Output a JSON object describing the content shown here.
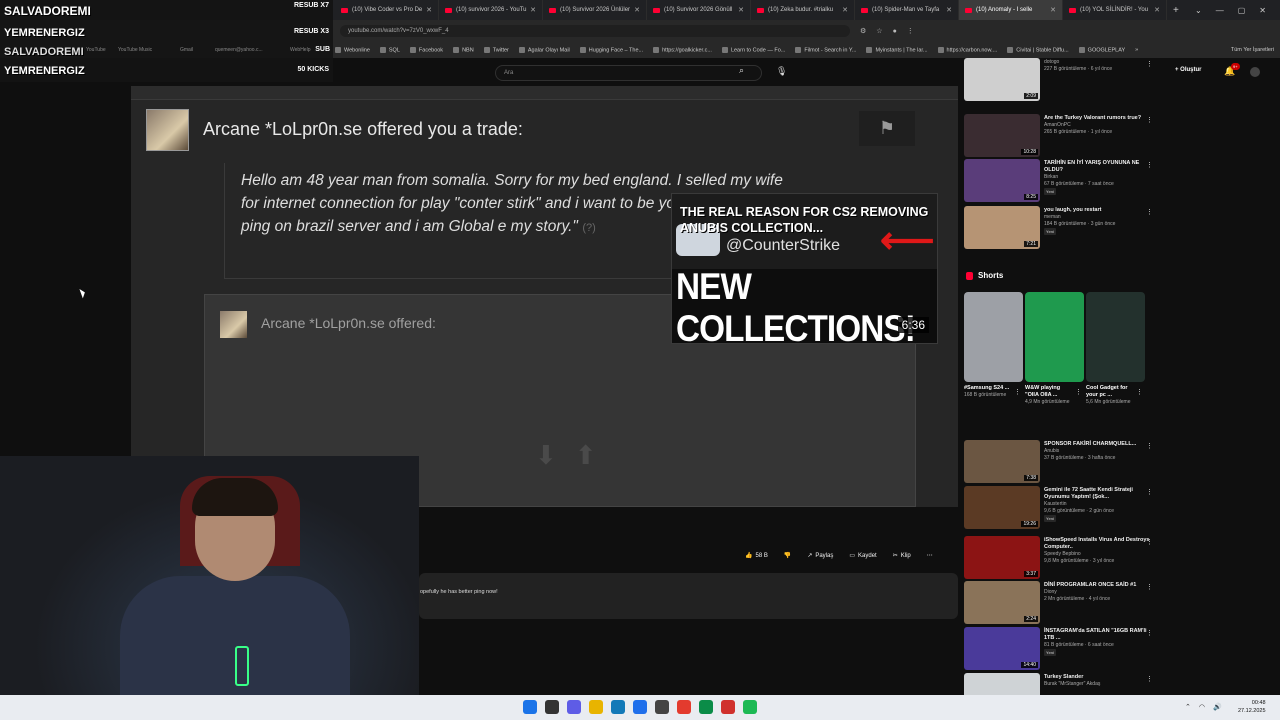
{
  "browser": {
    "tabs": [
      {
        "label": "(10) Vibe Coder vs Pro De",
        "active": false
      },
      {
        "label": "(10) survivor 2026 - YouTu",
        "active": false
      },
      {
        "label": "(10) Survivor 2026 Ünlüler",
        "active": false
      },
      {
        "label": "(10) Survivor 2026 Gönüll",
        "active": false
      },
      {
        "label": "(10) Zeka budur. #trialku",
        "active": false
      },
      {
        "label": "(10) Spider-Man ve Tayfa",
        "active": false
      },
      {
        "label": "(10) Anomaly - I selle",
        "active": true
      },
      {
        "label": "(10) YOL SİLİNDİR! - You",
        "active": false
      }
    ],
    "new_tab": "+",
    "url": "youtube.com/watch?v=7zV0_wxwF_4",
    "bookmarks": [
      "Webonline",
      "SQL",
      "Facebook",
      "NBN",
      "Twitter",
      "Agalar Olayı Mail",
      "Hugging Face – The...",
      "https://goalkicker.c...",
      "Learn to Code — Fo...",
      "Filmot - Search in Y...",
      "Myinstants | The lar...",
      "https://carbon.now....",
      "Civitai | Stable Diffu...",
      "GOOGLEPLAY"
    ],
    "bookmarks_overflow": "»",
    "all_bookmarks": "Tüm Yer İşaretleri"
  },
  "overlay": {
    "lines": [
      "SALVADOREMI",
      "YEMRENERGIZ",
      "SALVADOREMI",
      "YEMRENERGIZ"
    ],
    "tags": [
      "RESUB X7",
      "RESUB X3",
      "SUB",
      "50 KICKS"
    ],
    "faint": [
      "YouTube",
      "YouTube Music",
      "Gmail",
      "quemeen@yahoo.c...",
      "WebHelp"
    ]
  },
  "yt_header": {
    "search_placeholder": "Ara",
    "create_label": "Oluştur",
    "notif_count": "9+"
  },
  "video": {
    "trade_title": "Arcane *LoLpr0n.se offered you a trade:",
    "message": "Hello am 48 year man from somalia. Sorry for my bed england. I selled my wife for internet connection for play \"conter stirk\" and i want to be you I play with 400 ping on brazil server and i am Global e my story.\"",
    "message_q": "(?)",
    "offered_label": "Arcane *LoLpr0n.se offered:"
  },
  "preview": {
    "headline": "THE REAL REASON FOR CS2 REMOVING ANUBIS COLLECTION...",
    "handle": "@CounterStrike",
    "big_text": "NEW COLLECTIONS!",
    "duration": "6:36"
  },
  "actions": {
    "likes": "58 B",
    "share": "Paylaş",
    "save": "Kaydet",
    "clip": "Klip",
    "more": "⋯"
  },
  "comment_text": "opefully he has better ping now!",
  "sidebar": {
    "videos_top": [
      {
        "title": "",
        "channel": "dotogo",
        "meta": "227 B görüntüleme · 6 yıl önce",
        "duration": "2:09",
        "color": "#cfcfcf",
        "new": ""
      },
      {
        "title": "Are the Turkey Valorant rumors true?",
        "channel": "AmanOnPC",
        "meta": "265 B görüntüleme · 1 yıl önce",
        "duration": "10:28",
        "color": "#3a2c31",
        "new": ""
      },
      {
        "title": "TARİHİN EN İYİ YARIŞ OYUNUNA NE OLDU?",
        "channel": "Birkan",
        "meta": "67 B görüntüleme · 7 saat önce",
        "duration": "8:25",
        "color": "#5a3d7a",
        "new": "Yeni"
      },
      {
        "title": "you laugh, you restart",
        "channel": "meman",
        "meta": "184 B görüntüleme · 3 gün önce",
        "duration": "7:21",
        "color": "#b69474",
        "new": "Yeni"
      }
    ],
    "shorts_label": "Shorts",
    "shorts": [
      {
        "title": "#Samsung S24 ...",
        "meta": "168 B görüntüleme",
        "color": "#9da0a6"
      },
      {
        "title": "W&W playing \"OIIA OIIA ...",
        "meta": "4,9 Mn görüntüleme",
        "color": "#1f9a4e"
      },
      {
        "title": "Cool Gadget for your pc ...",
        "meta": "5,6 Mn görüntüleme",
        "color": "#23312d"
      }
    ],
    "videos_bottom": [
      {
        "title": "SPONSOR FAKİRİ CHARMQUELL...",
        "channel": "Anubis",
        "meta": "37 B görüntüleme · 3 hafta önce",
        "duration": "7:38",
        "color": "#6b5642",
        "new": ""
      },
      {
        "title": "Gemini ile 72 Saatte Kendi Strateji Oyunumu Yaptım! (Şok...",
        "channel": "Kaustertin",
        "meta": "9,6 B görüntüleme · 2 gün önce",
        "duration": "19:26",
        "color": "#5b3a24",
        "new": "Yeni"
      },
      {
        "title": "iShowSpeed Installs Virus And Destroys Computer..",
        "channel": "Speedy Bepbino",
        "meta": "9,8 Mn görüntüleme · 3 yıl önce",
        "duration": "3:37",
        "color": "#8c1414",
        "new": ""
      },
      {
        "title": "DİNİ PROGRAMLAR ONCE SAİD #1",
        "channel": "Diony",
        "meta": "2 Mn görüntüleme · 4 yıl önce",
        "duration": "2:24",
        "color": "#8a7359",
        "new": ""
      },
      {
        "title": "İNSTAGRAM'da SATILAN \"16GB RAM'li 1TB ...",
        "channel": "",
        "meta": "81 B görüntüleme · 6 saat önce",
        "duration": "14:40",
        "color": "#4a3a9a",
        "new": "Yeni"
      },
      {
        "title": "Turkey Slander",
        "channel": "Burak \"MrStanger\" Akdaş",
        "meta": "",
        "duration": "",
        "color": "#cfd3d6",
        "new": ""
      }
    ]
  },
  "taskbar": {
    "time": "00:48",
    "date": "27.12.2025",
    "icon_colors": [
      "#1a73e8",
      "#333333",
      "#5e5ce6",
      "#e8b400",
      "#1279b8",
      "#1f6feb",
      "#444444",
      "#e33b2e",
      "#0b8c48",
      "#d0312d",
      "#1db954"
    ]
  }
}
